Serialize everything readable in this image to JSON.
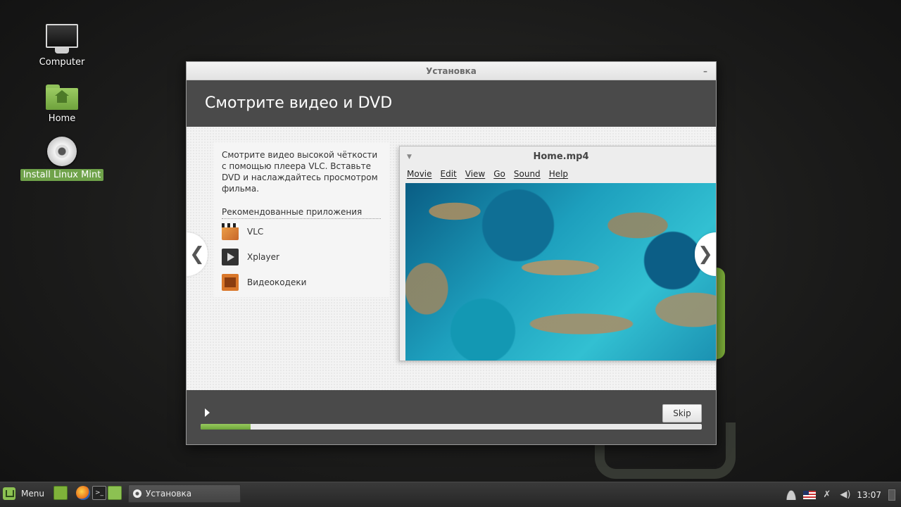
{
  "desktop": {
    "icons": [
      {
        "label": "Computer",
        "icon": "computer-icon"
      },
      {
        "label": "Home",
        "icon": "home-folder-icon"
      },
      {
        "label": "Install Linux Mint",
        "icon": "disc-icon"
      }
    ]
  },
  "installer": {
    "window_title": "Установка",
    "minimize": "–",
    "slide_title": "Смотрите видео и DVD",
    "description": "Смотрите видео высокой чёткости с помощью плеера VLC. Вставьте DVD и наслаждайтесь просмотром фильма.",
    "apps_heading": "Рекомендованные приложения",
    "apps": [
      {
        "name": "VLC",
        "icon": "vlc-icon"
      },
      {
        "name": "Xplayer",
        "icon": "xplayer-icon"
      },
      {
        "name": "Видеокодеки",
        "icon": "codecs-icon"
      }
    ],
    "prev_arrow": "❮",
    "next_arrow": "❯",
    "player": {
      "title": "Home.mp4",
      "dropdown": "▼",
      "menu": [
        "Movie",
        "Edit",
        "View",
        "Go",
        "Sound",
        "Help"
      ]
    },
    "skip_label": "Skip",
    "progress": 0.1
  },
  "taskbar": {
    "menu_label": "Menu",
    "terminal_glyph": ">_",
    "task_label": "Установка",
    "network_glyph": "✗",
    "volume_glyph": "◀)",
    "clock": "13:07"
  },
  "colors": {
    "accent": "#7fb23a",
    "header_band": "#4a4a4a"
  }
}
